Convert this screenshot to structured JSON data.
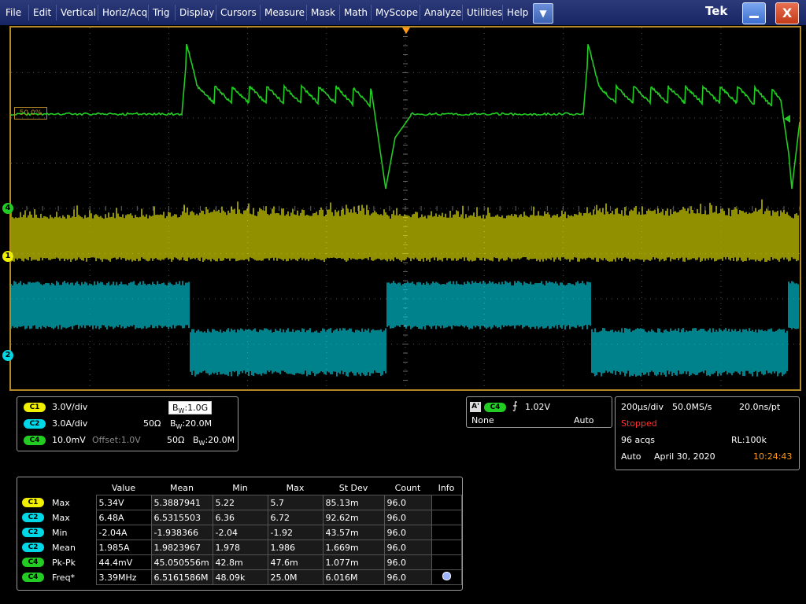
{
  "menu": {
    "items": [
      "File",
      "Edit",
      "Vertical",
      "Horiz/Acq",
      "Trig",
      "Display",
      "Cursors",
      "Measure",
      "Mask",
      "Math",
      "MyScope",
      "Analyze",
      "Utilities",
      "Help"
    ],
    "dropdown_glyph": "▼",
    "logo": "Tek",
    "minimize_icon": "minimize-icon",
    "close_glyph": "X"
  },
  "graticule": {
    "ref_label": "50.0%",
    "markers": [
      {
        "label": "4",
        "color": "#22cc22"
      },
      {
        "label": "1",
        "color": "#f0f000"
      },
      {
        "label": "2",
        "color": "#00d8e8"
      }
    ]
  },
  "chart_data": {
    "type": "line",
    "title": "",
    "xlabel": "",
    "ylabel": "",
    "grid": true,
    "x_divisions": 10,
    "y_divisions": 8,
    "series": [
      {
        "name": "C1",
        "color": "#f0f000",
        "description": "switching node, dense burst ~3.4MHz, amplitude about 5.3V"
      },
      {
        "name": "C2",
        "color": "#00d8e8",
        "description": "current: high ~0.6div block, then low block with noisy band"
      },
      {
        "name": "C4",
        "color": "#22cc22",
        "description": "ripple: flat, then spike and decaying sawtooth ripple, then negative dip"
      }
    ]
  },
  "channels": [
    {
      "badge": "C1",
      "scale": "3.0V/div",
      "impedance": "",
      "bw_prefix": "B",
      "bw_sub": "W",
      "bw": ":1.0G",
      "offset": ""
    },
    {
      "badge": "C2",
      "scale": "3.0A/div",
      "impedance": "50Ω",
      "bw_prefix": "B",
      "bw_sub": "W",
      "bw": ":20.0M",
      "offset": ""
    },
    {
      "badge": "C4",
      "scale": "10.0mV",
      "impedance": "50Ω",
      "bw_prefix": "B",
      "bw_sub": "W",
      "bw": ":20.0M",
      "offset": "Offset:1.0V"
    }
  ],
  "trigger": {
    "a_badge": "A'",
    "source_badge": "C4",
    "slope_glyph": "⨍",
    "level": "1.02V",
    "coupling": "None",
    "mode": "Auto"
  },
  "horizontal": {
    "scale": "200µs/div",
    "sample_rate": "50.0MS/s",
    "resolution": "20.0ns/pt",
    "status": "Stopped",
    "acqs": "96 acqs",
    "record_length": "RL:100k",
    "mode": "Auto",
    "date": "April 30, 2020",
    "time": "10:24:43"
  },
  "measurements": {
    "headers": [
      "Value",
      "Mean",
      "Min",
      "Max",
      "St Dev",
      "Count",
      "Info"
    ],
    "rows": [
      {
        "badge": "C1",
        "name": "Max",
        "value": "5.34V",
        "mean": "5.3887941",
        "min": "5.22",
        "max": "5.7",
        "stdev": "85.13m",
        "count": "96.0",
        "info": ""
      },
      {
        "badge": "C2",
        "name": "Max",
        "value": "6.48A",
        "mean": "6.5315503",
        "min": "6.36",
        "max": "6.72",
        "stdev": "92.62m",
        "count": "96.0",
        "info": ""
      },
      {
        "badge": "C2",
        "name": "Min",
        "value": "-2.04A",
        "mean": "-1.938366",
        "min": "-2.04",
        "max": "-1.92",
        "stdev": "43.57m",
        "count": "96.0",
        "info": ""
      },
      {
        "badge": "C2",
        "name": "Mean",
        "value": "1.985A",
        "mean": "1.9823967",
        "min": "1.978",
        "max": "1.986",
        "stdev": "1.669m",
        "count": "96.0",
        "info": ""
      },
      {
        "badge": "C4",
        "name": "Pk-Pk",
        "value": "44.4mV",
        "mean": "45.050556m",
        "min": "42.8m",
        "max": "47.6m",
        "stdev": "1.077m",
        "count": "96.0",
        "info": ""
      },
      {
        "badge": "C4",
        "name": "Freq*",
        "value": "3.39MHz",
        "mean": "6.5161586M",
        "min": "48.09k",
        "max": "25.0M",
        "stdev": "6.016M",
        "count": "96.0",
        "info": "info-icon"
      }
    ]
  },
  "colors": {
    "c1": "#f0f000",
    "c2": "#00d8e8",
    "c4": "#22cc22",
    "frame": "#b48a28",
    "stopped": "#ff3030",
    "time": "#ff9a1a"
  }
}
